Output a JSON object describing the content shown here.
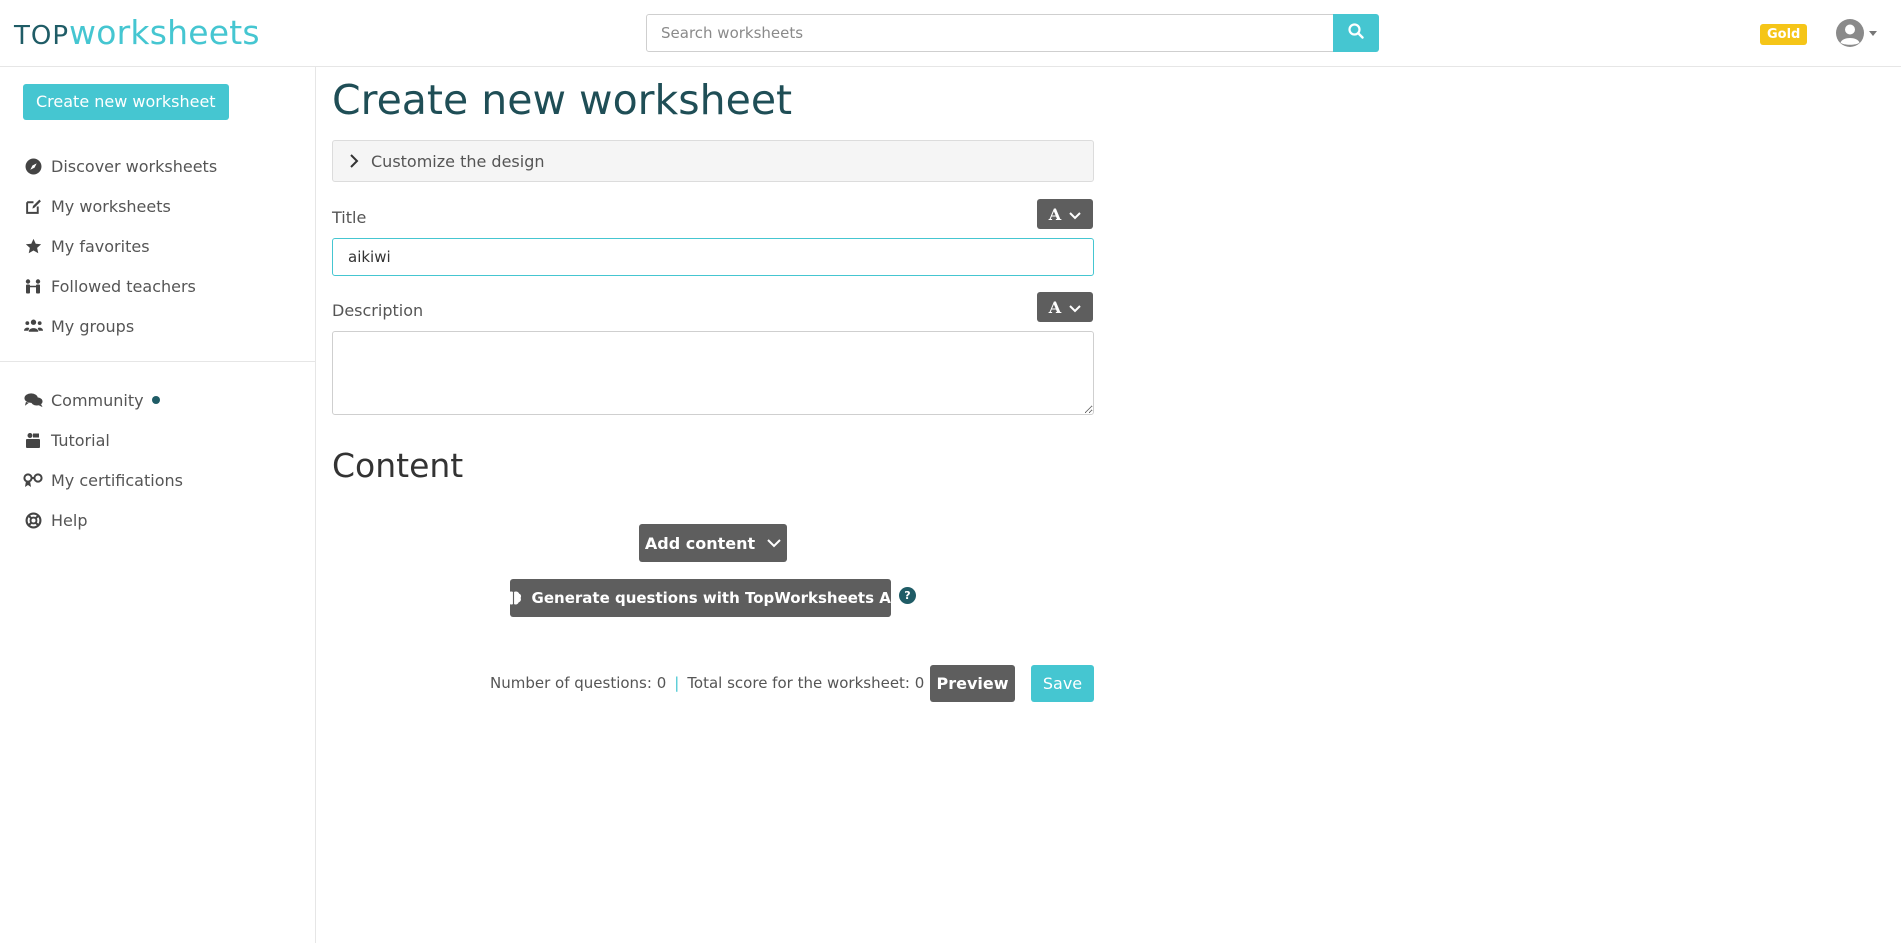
{
  "header": {
    "logo_top": "TOP",
    "logo_worksheets": "worksheets",
    "search_placeholder": "Search worksheets",
    "badge": "Gold",
    "colors": {
      "accent": "#45c6d1",
      "dark_teal": "#1f5c66",
      "gold": "#f5c518"
    }
  },
  "sidebar": {
    "create_button": "Create new worksheet",
    "items": [
      {
        "label": "Discover worksheets",
        "icon": "compass-icon"
      },
      {
        "label": "My worksheets",
        "icon": "edit-icon"
      },
      {
        "label": "My favorites",
        "icon": "star-icon"
      },
      {
        "label": "Followed teachers",
        "icon": "teachers-icon"
      },
      {
        "label": "My groups",
        "icon": "groups-icon"
      }
    ],
    "secondary_items": [
      {
        "label": "Community",
        "icon": "comments-icon"
      },
      {
        "label": "Tutorial",
        "icon": "tutorial-icon"
      },
      {
        "label": "My certifications",
        "icon": "certificate-icon"
      },
      {
        "label": "Help",
        "icon": "lifebuoy-icon"
      }
    ]
  },
  "main": {
    "title": "Create new worksheet",
    "customize_label": "Customize the design",
    "title_label": "Title",
    "title_value": "aikiwi",
    "description_label": "Description",
    "description_value": "",
    "font_button_glyph": "A",
    "content_heading": "Content",
    "add_content_label": "Add content",
    "ai_button_label": "Generate questions with TopWorksheets AI",
    "help_glyph": "?",
    "questions_count_text": "Number of questions: 0",
    "separator": "|",
    "total_score_text": "Total score for the worksheet: 0",
    "preview_label": "Preview",
    "save_label": "Save"
  }
}
